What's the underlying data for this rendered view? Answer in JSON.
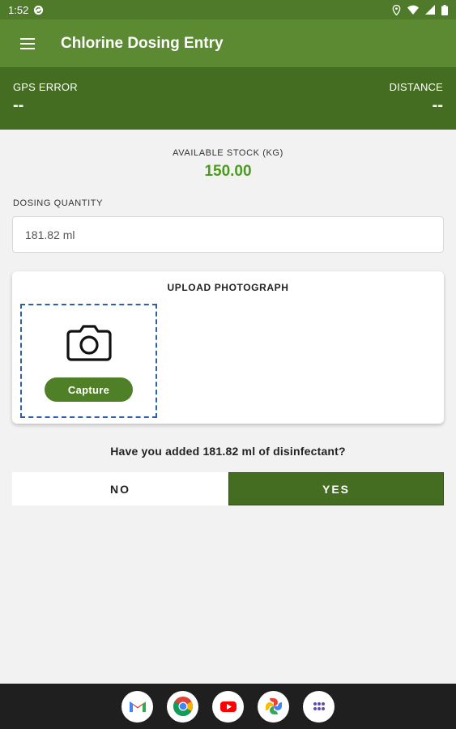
{
  "status_bar": {
    "time": "1:52"
  },
  "app_bar": {
    "title": "Chlorine Dosing Entry"
  },
  "info_bar": {
    "gps_error_label": "GPS ERROR",
    "gps_error_value": "--",
    "distance_label": "DISTANCE",
    "distance_value": "--"
  },
  "stock": {
    "label": "AVAILABLE STOCK (KG)",
    "value": "150.00"
  },
  "dosing": {
    "label": "DOSING QUANTITY",
    "value": "181.82 ml"
  },
  "upload": {
    "title": "UPLOAD PHOTOGRAPH",
    "capture_label": "Capture"
  },
  "confirm": {
    "question": "Have you added 181.82 ml of disinfectant?",
    "no_label": "NO",
    "yes_label": "YES"
  },
  "dock": {
    "apps": [
      "gmail-icon",
      "chrome-icon",
      "youtube-icon",
      "photos-icon",
      "app-drawer-icon"
    ]
  },
  "colors": {
    "app_bar": "#5b8a33",
    "info_bar": "#456d21",
    "accent_green": "#4d9a22",
    "capture_border": "#2f5fa8"
  }
}
